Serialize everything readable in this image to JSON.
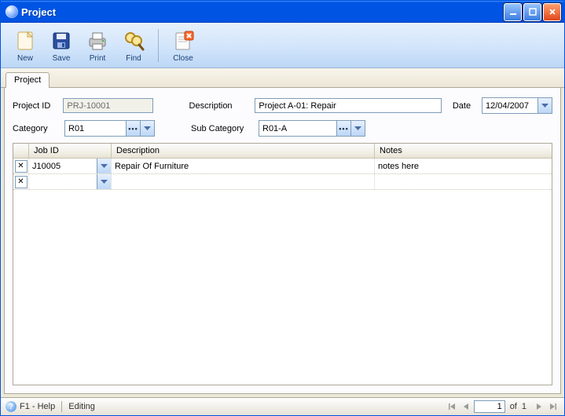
{
  "window": {
    "title": "Project"
  },
  "toolbar": {
    "new": "New",
    "save": "Save",
    "print": "Print",
    "find": "Find",
    "close": "Close"
  },
  "tabs": {
    "project": "Project"
  },
  "form": {
    "project_id_label": "Project ID",
    "project_id_value": "PRJ-10001",
    "description_label": "Description",
    "description_value": "Project A-01: Repair",
    "date_label": "Date",
    "date_value": "12/04/2007",
    "category_label": "Category",
    "category_value": "R01",
    "subcategory_label": "Sub Category",
    "subcategory_value": "R01-A"
  },
  "grid": {
    "headers": {
      "job_id": "Job ID",
      "description": "Description",
      "notes": "Notes"
    },
    "rows": [
      {
        "job_id": "J10005",
        "description": "Repair Of Furniture",
        "notes": "notes here"
      },
      {
        "job_id": "",
        "description": "",
        "notes": ""
      }
    ]
  },
  "status": {
    "help": "F1 - Help",
    "mode": "Editing",
    "page_current": "1",
    "page_of": "of",
    "page_total": "1"
  }
}
